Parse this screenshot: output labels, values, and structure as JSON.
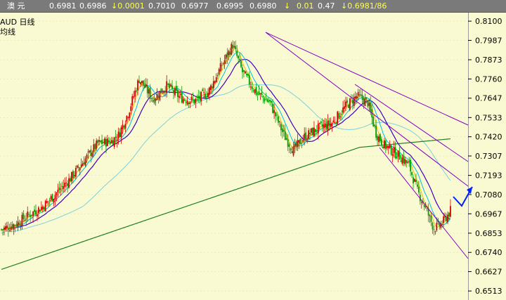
{
  "quote_bar": {
    "name": "澳 元",
    "last": "0.6981",
    "buy": "0.6986",
    "change_prefix": "↓0.0001",
    "open": "0.7010",
    "low": "0.6977",
    "high": "0.6995",
    "close": "0.6980",
    "arrow": "↓",
    "chg2": "0.01",
    "pct": "0.47",
    "tail": "↓0.6981/86"
  },
  "chart_title": "AUD  日线",
  "chart_subtitle": "均线",
  "chart_data": {
    "type": "candlestick",
    "ylim": [
      0.646,
      0.815
    ],
    "y_ticks": [
      "0.8100",
      "0.7987",
      "0.7873",
      "0.7760",
      "0.7647",
      "0.7533",
      "0.7420",
      "0.7307",
      "0.7193",
      "0.7080",
      "0.6967",
      "0.6853",
      "0.6740",
      "0.6627",
      "0.6513"
    ],
    "tick_values": [
      0.81,
      0.7987,
      0.7873,
      0.776,
      0.7647,
      0.7533,
      0.742,
      0.7307,
      0.7193,
      0.708,
      0.6967,
      0.6853,
      0.674,
      0.6627,
      0.6513
    ],
    "anchors": [
      [
        0,
        0.6875
      ],
      [
        10,
        0.6905
      ],
      [
        20,
        0.696
      ],
      [
        30,
        0.701
      ],
      [
        40,
        0.709
      ],
      [
        50,
        0.7175
      ],
      [
        60,
        0.728
      ],
      [
        70,
        0.738
      ],
      [
        80,
        0.7395
      ],
      [
        85,
        0.743
      ],
      [
        92,
        0.756
      ],
      [
        100,
        0.776
      ],
      [
        110,
        0.764
      ],
      [
        120,
        0.772
      ],
      [
        130,
        0.765
      ],
      [
        140,
        0.763
      ],
      [
        150,
        0.768
      ],
      [
        160,
        0.784
      ],
      [
        168,
        0.796
      ],
      [
        175,
        0.78
      ],
      [
        185,
        0.768
      ],
      [
        195,
        0.762
      ],
      [
        205,
        0.743
      ],
      [
        212,
        0.734
      ],
      [
        220,
        0.742
      ],
      [
        230,
        0.747
      ],
      [
        240,
        0.75
      ],
      [
        250,
        0.76
      ],
      [
        258,
        0.766
      ],
      [
        266,
        0.762
      ],
      [
        272,
        0.744
      ],
      [
        278,
        0.737
      ],
      [
        285,
        0.733
      ],
      [
        290,
        0.73
      ],
      [
        296,
        0.725
      ],
      [
        302,
        0.71
      ],
      [
        308,
        0.7
      ],
      [
        314,
        0.688
      ],
      [
        320,
        0.691
      ],
      [
        326,
        0.6985
      ]
    ],
    "colors": {
      "up": "#d40000",
      "down": "#00a000",
      "ma5": "#e8c000",
      "ma10": "#00c0d8",
      "ma20": "#4000c0",
      "ma60": "#7fd0d8",
      "ma120": "#208020",
      "channel": "#8000c0",
      "forecast": "#0020ff"
    }
  }
}
